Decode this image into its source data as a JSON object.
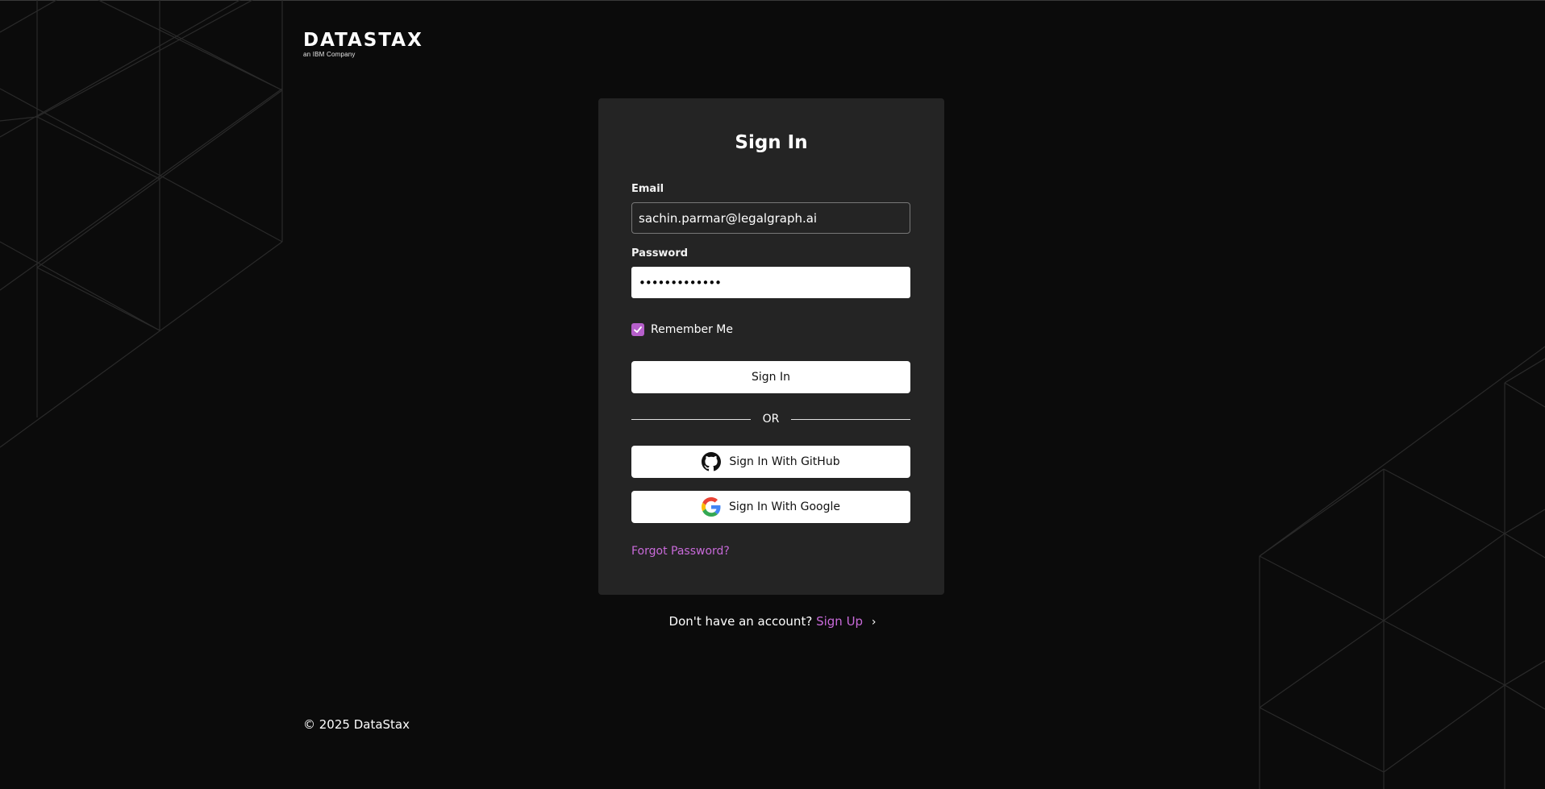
{
  "brand": {
    "name": "DATASTAX",
    "tagline": "an IBM Company"
  },
  "signin": {
    "title": "Sign In",
    "email_label": "Email",
    "email_value": "sachin.parmar@legalgraph.ai",
    "password_label": "Password",
    "password_value": "•••••••••••••",
    "remember_label": "Remember Me",
    "remember_checked": true,
    "submit_label": "Sign In",
    "or_label": "OR",
    "github_label": "Sign In With GitHub",
    "google_label": "Sign In With Google",
    "forgot_label": "Forgot Password?"
  },
  "signup": {
    "prompt": "Don't have an account?",
    "link_label": "Sign Up",
    "chevron": "›"
  },
  "footer": {
    "copyright": "© 2025 DataStax"
  },
  "colors": {
    "background": "#0b0b0b",
    "card": "#242424",
    "accent": "#b65fcb",
    "link": "#c86ad9"
  },
  "icons": {
    "github": "github-icon",
    "google": "google-icon",
    "check": "check-icon",
    "chevron": "chevron-right-icon"
  }
}
